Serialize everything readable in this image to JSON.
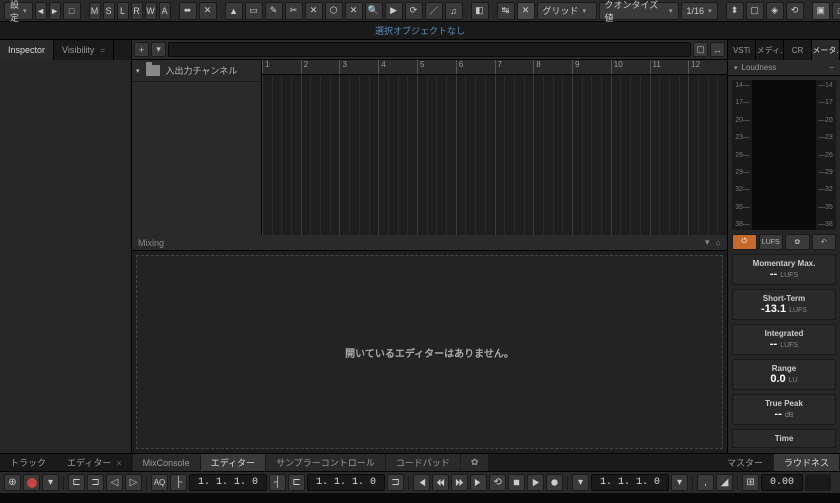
{
  "toolbar": {
    "settings_label": "設定",
    "letters": [
      "M",
      "S",
      "L",
      "R",
      "W",
      "A"
    ],
    "snap_label": "グリッド",
    "quantize_label": "クオンタイズ値",
    "quantize_value": "1/16"
  },
  "info_bar": "選択オブジェクトなし",
  "left_tabs": {
    "inspector": "Inspector",
    "visibility": "Visibility"
  },
  "track_header": {
    "add": "+"
  },
  "tracks": [
    {
      "name": "入出力チャンネル"
    }
  ],
  "ruler_marks": [
    1,
    2,
    3,
    4,
    5,
    6,
    7,
    8,
    9,
    10,
    11,
    12
  ],
  "mixing_label": "Mixing",
  "editor_empty": "開いているエディターはありません。",
  "right_tabs": {
    "vsti": "VSTi",
    "media": "メディ.",
    "cr": "CR",
    "meter": "メータ."
  },
  "loudness": {
    "header": "Loudness",
    "scale": [
      14,
      17,
      20,
      23,
      26,
      29,
      32,
      35,
      38
    ],
    "btn_lufs": "LUFS",
    "stats": {
      "momentary": {
        "label": "Momentary Max.",
        "value": "--",
        "unit": "LUFS"
      },
      "short_term": {
        "label": "Short-Term",
        "value": "-13.1",
        "unit": "LUFS"
      },
      "integrated": {
        "label": "Integrated",
        "value": "--",
        "unit": "LUFS"
      },
      "range": {
        "label": "Range",
        "value": "0.0",
        "unit": "LU"
      },
      "true_peak": {
        "label": "True Peak",
        "value": "--",
        "unit": "dB"
      },
      "time": {
        "label": "Time",
        "value": "",
        "unit": ""
      }
    }
  },
  "bottom_tabs": {
    "track": "トラック",
    "editor": "エディター",
    "mixconsole": "MixConsole",
    "editor2": "エディター",
    "sampler": "サンプラーコントロール",
    "chord": "コードパッド",
    "master": "マスター",
    "loudness": "ラウドネス"
  },
  "transport": {
    "pos1": "1. 1. 1.   0",
    "pos2": "1. 1. 1.   0",
    "pos3": "1. 1. 1.   0",
    "tempo_sym": ",",
    "tempo_end": "0.00",
    "aq": "AQ"
  }
}
